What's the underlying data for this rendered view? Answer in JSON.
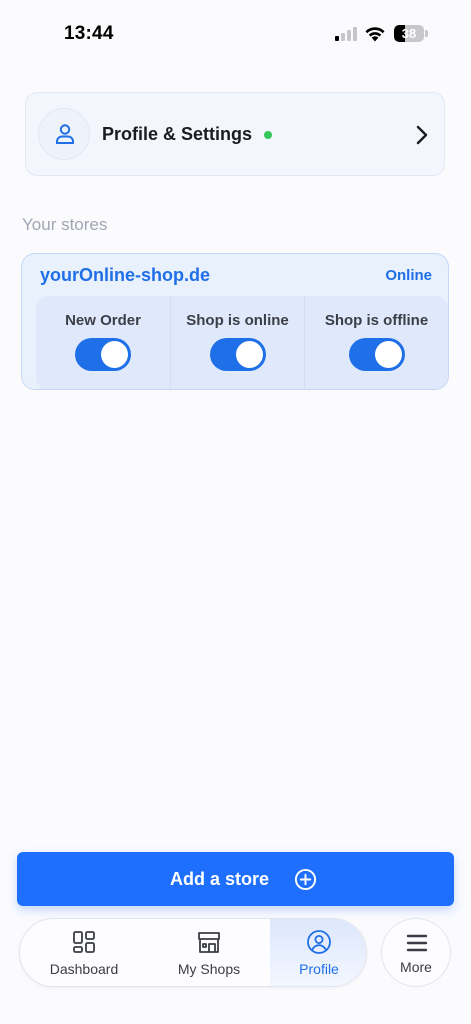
{
  "status_bar": {
    "time": "13:44",
    "battery": "38",
    "battery_level": 0.38,
    "signal_bars": 1,
    "icons": [
      "cellular-signal-icon",
      "wifi-icon",
      "battery-icon"
    ]
  },
  "profile_card": {
    "label": "Profile & Settings",
    "status_color": "#34c759",
    "icons": [
      "user-icon",
      "chevron-right-icon"
    ]
  },
  "stores_section": {
    "title": "Your stores"
  },
  "store": {
    "name": "yourOnline-shop.de",
    "status": "Online",
    "toggles": [
      {
        "label": "New Order",
        "on": true
      },
      {
        "label": "Shop is online",
        "on": true
      },
      {
        "label": "Shop is offline",
        "on": true
      }
    ]
  },
  "add_store": {
    "label": "Add a store",
    "icon": "plus-circle-icon"
  },
  "bottom_nav": {
    "items": [
      {
        "label": "Dashboard",
        "icon": "dashboard-grid-icon",
        "active": false
      },
      {
        "label": "My Shops",
        "icon": "store-icon",
        "active": false
      },
      {
        "label": "Profile",
        "icon": "profile-circle-icon",
        "active": true
      }
    ],
    "more": {
      "label": "More",
      "icon": "menu-icon"
    }
  },
  "colors": {
    "accent": "#1f6fe8",
    "button": "#1f6fff",
    "online": "#34c759",
    "muted_text": "#a0a6b3"
  }
}
